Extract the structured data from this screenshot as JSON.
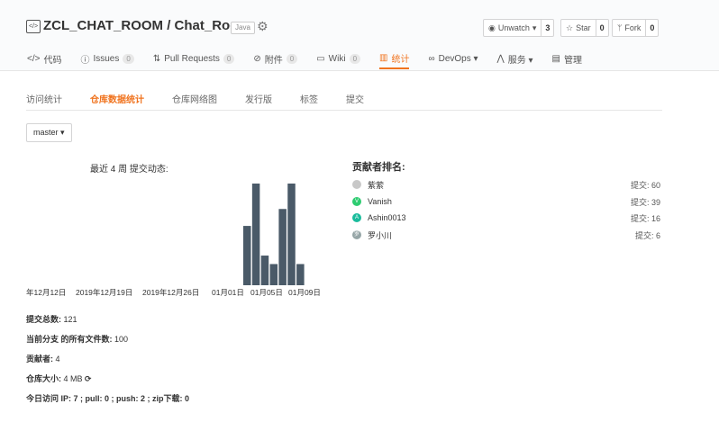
{
  "repo": {
    "title": "ZCL_CHAT_ROOM / Chat_Room",
    "language": "Java",
    "unwatch_label": "Unwatch",
    "unwatch_count": "3",
    "star_label": "Star",
    "star_count": "0",
    "fork_label": "Fork",
    "fork_count": "0"
  },
  "tabs": [
    {
      "icon": "</>",
      "label": "代码",
      "badge": ""
    },
    {
      "icon": "ⓘ",
      "label": "Issues",
      "badge": "0"
    },
    {
      "icon": "⇅",
      "label": "Pull Requests",
      "badge": "0"
    },
    {
      "icon": "⊘",
      "label": "附件",
      "badge": "0"
    },
    {
      "icon": "▭",
      "label": "Wiki",
      "badge": "0"
    },
    {
      "icon": "▥",
      "label": "统计",
      "badge": ""
    },
    {
      "icon": "∞",
      "label": "DevOps ▾",
      "badge": ""
    },
    {
      "icon": "⋀",
      "label": "服务 ▾",
      "badge": ""
    },
    {
      "icon": "▤",
      "label": "管理",
      "badge": ""
    }
  ],
  "subnav": [
    "访问统计",
    "仓库数据统计",
    "仓库网络图",
    "发行版",
    "标签",
    "提交"
  ],
  "branch": "master ▾",
  "commit_chart": {
    "title": "最近 4 周 提交动态:",
    "color": "#4a5a68"
  },
  "chart_data": {
    "type": "bar",
    "title": "最近 4 周 提交动态:",
    "xlabel": "",
    "ylabel": "",
    "tick_labels": [
      "年12月12日",
      "2019年12月19日",
      "2019年12月26日",
      "01月01日",
      "01月05日",
      "01月09日"
    ],
    "values": [
      14,
      24,
      7,
      5,
      18,
      24,
      5
    ]
  },
  "contributors": {
    "title": "贡献者排名:",
    "items": [
      {
        "name": "紫萦",
        "commits": "提交: 60",
        "avatar_color": "#c8c8c8",
        "initial": ""
      },
      {
        "name": "Vanish",
        "commits": "提交: 39",
        "avatar_color": "#2ecc71",
        "initial": "V"
      },
      {
        "name": "Ashin0013",
        "commits": "提交: 16",
        "avatar_color": "#1abc9c",
        "initial": "A"
      },
      {
        "name": "罗小川",
        "commits": "提交: 6",
        "avatar_color": "#95a5a6",
        "initial": "罗"
      }
    ]
  },
  "stats": {
    "total_commits_label": "提交总数:",
    "total_commits": " 121",
    "files_label": "当前分支 的所有文件数:",
    "files": " 100",
    "contributors_label": "贡献者:",
    "contributors": " 4",
    "size_label": "仓库大小:",
    "size": " 4 MB",
    "today_label": "今日访问 IP: 7 ; pull: 0 ; push: 2 ; zip下载: 0"
  }
}
